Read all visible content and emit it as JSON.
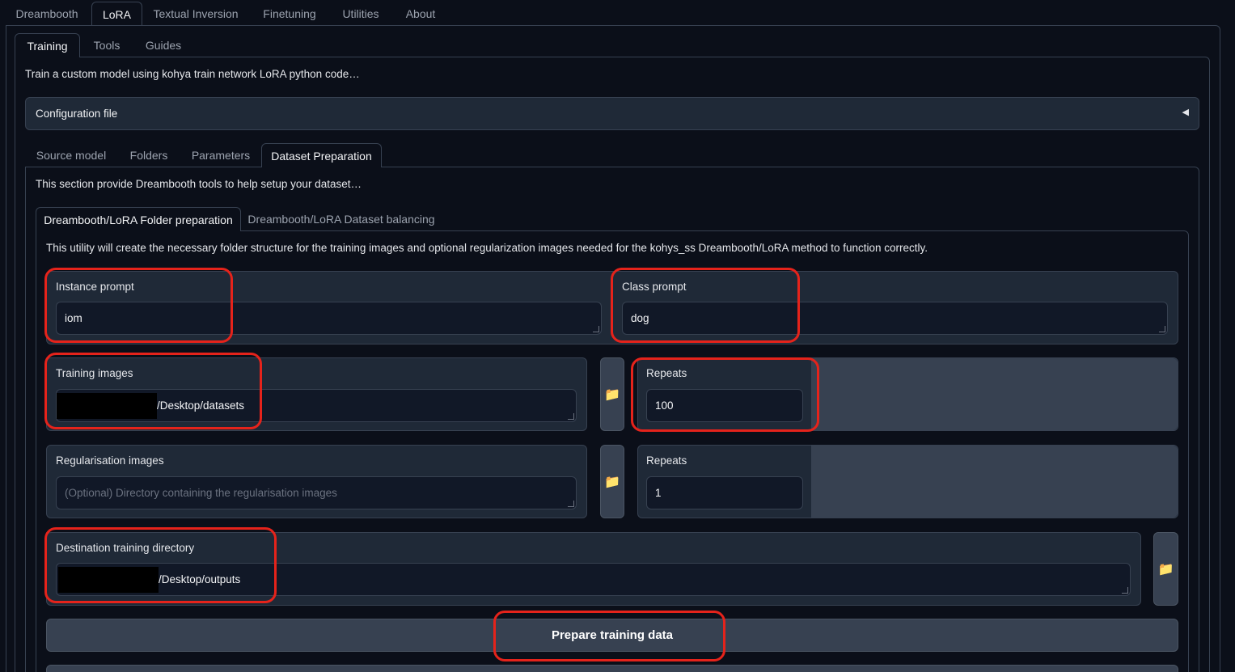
{
  "top_tabs": [
    "Dreambooth",
    "LoRA",
    "Textual Inversion",
    "Finetuning",
    "Utilities",
    "About"
  ],
  "sub_tabs": [
    "Training",
    "Tools",
    "Guides"
  ],
  "training_description": "Train a custom model using kohya train network LoRA python code…",
  "config_accordion": {
    "label": "Configuration file",
    "arrow": "◀"
  },
  "section_tabs": [
    "Source model",
    "Folders",
    "Parameters",
    "Dataset Preparation"
  ],
  "section_description": "This section provide Dreambooth tools to help setup your dataset…",
  "dataset_tabs": [
    "Dreambooth/LoRA Folder preparation",
    "Dreambooth/LoRA Dataset balancing"
  ],
  "utility_description": "This utility will create the necessary folder structure for the training images and optional regularization images needed for the kohys_ss Dreambooth/LoRA method to function correctly.",
  "instance_prompt": {
    "label": "Instance prompt",
    "value": "iom"
  },
  "class_prompt": {
    "label": "Class prompt",
    "value": "dog"
  },
  "training_images": {
    "label": "Training images",
    "value": "/Desktop/datasets"
  },
  "training_repeats": {
    "label": "Repeats",
    "value": "100"
  },
  "regularisation_images": {
    "label": "Regularisation images",
    "placeholder": "(Optional) Directory containing the regularisation images"
  },
  "regularisation_repeats": {
    "label": "Repeats",
    "value": "1"
  },
  "destination_dir": {
    "label": "Destination training directory",
    "value": "/Desktop/outputs"
  },
  "prepare_button": "Prepare training data",
  "icons": {
    "folder": "folder-icon"
  },
  "colors": {
    "highlight": "#e5231b",
    "background": "#0b0f19",
    "block": "#1f2937"
  }
}
